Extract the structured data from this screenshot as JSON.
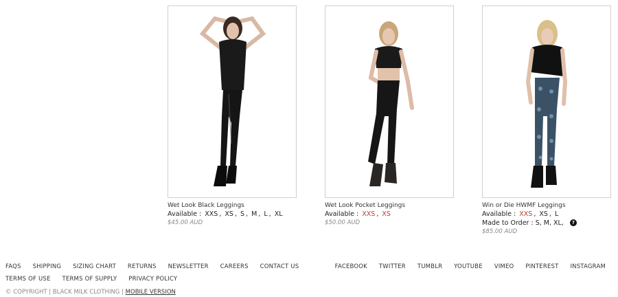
{
  "products": [
    {
      "name": "Wet Look Black Leggings",
      "available_label": "Available :",
      "sizes": [
        {
          "label": "XXS",
          "status": "in"
        },
        {
          "label": "XS",
          "status": "in"
        },
        {
          "label": "S",
          "status": "in"
        },
        {
          "label": "M",
          "status": "in"
        },
        {
          "label": "L",
          "status": "in"
        },
        {
          "label": "XL",
          "status": "in"
        }
      ],
      "price": "$45.00 AUD"
    },
    {
      "name": "Wet Look Pocket Leggings",
      "available_label": "Available :",
      "sizes": [
        {
          "label": "XXS",
          "status": "out"
        },
        {
          "label": "XS",
          "status": "out"
        }
      ],
      "price": "$50.00 AUD"
    },
    {
      "name": "Win or Die HWMF Leggings",
      "available_label": "Available :",
      "sizes": [
        {
          "label": "XXS",
          "status": "out"
        },
        {
          "label": "XS",
          "status": "in"
        },
        {
          "label": "L",
          "status": "in"
        }
      ],
      "made_to_order_label": "Made to Order :",
      "made_to_order_sizes": "S, M, XL,",
      "price": "$85.00 AUD"
    }
  ],
  "footer": {
    "row1": [
      "FAQS",
      "SHIPPING",
      "SIZING CHART",
      "RETURNS",
      "NEWSLETTER",
      "CAREERS",
      "CONTACT US"
    ],
    "row2": [
      "TERMS OF USE",
      "TERMS OF SUPPLY",
      "PRIVACY POLICY"
    ],
    "social": [
      "FACEBOOK",
      "TWITTER",
      "TUMBLR",
      "YOUTUBE",
      "VIMEO",
      "PINTEREST",
      "INSTAGRAM"
    ],
    "copyright": "© COPYRIGHT | BLACK MILK CLOTHING |",
    "mobile_version": "MOBILE VERSION"
  },
  "colors": {
    "out_of_stock": "#c0392b",
    "price": "#888888"
  }
}
